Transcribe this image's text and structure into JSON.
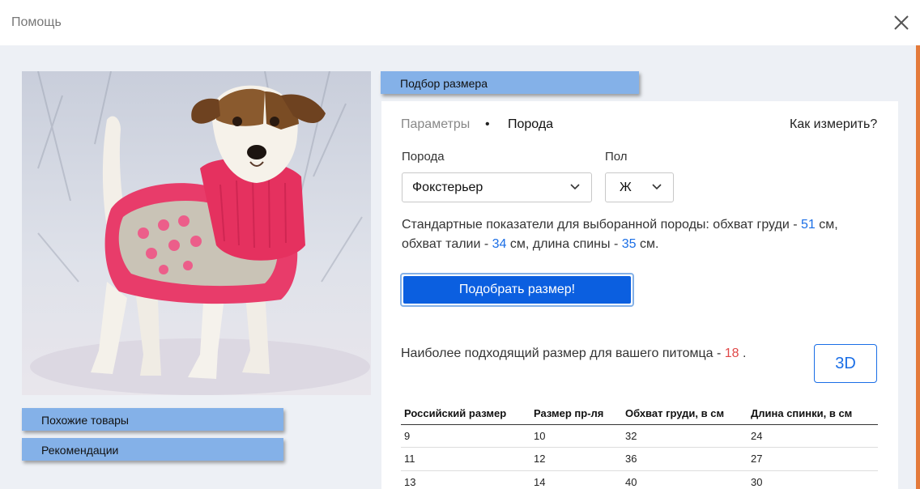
{
  "window": {
    "title": "Помощь",
    "close_icon": "close-icon"
  },
  "photo": {
    "alt_subject": "dog-in-pink-sweater-image"
  },
  "side_buttons": [
    {
      "label": "Похожие товары"
    },
    {
      "label": "Рекомендации"
    }
  ],
  "tab": {
    "label": "Подбор размера"
  },
  "steps": {
    "params": "Параметры",
    "separator": "•",
    "breed": "Порода"
  },
  "how_to_measure": "Как измерить?",
  "form": {
    "breed_label": "Порода",
    "breed_value": "Фокстерьер",
    "sex_label": "Пол",
    "sex_value": "Ж"
  },
  "standard": {
    "prefix": "Стандартные показатели для выборанной породы: обхват груди - ",
    "chest": "51",
    "mid1": " см, обхват талии - ",
    "waist": "34",
    "mid2": " см, длина спины - ",
    "back": "35",
    "suffix": " см."
  },
  "submit_label": "Подобрать размер!",
  "result": {
    "prefix": "Наиболее подходящий размер для вашего питомца - ",
    "size": "18",
    "suffix": " ."
  },
  "btn_3d": "3D",
  "table": {
    "headers": [
      "Российский размер",
      "Размер пр-ля",
      "Обхват груди, в см",
      "Длина спинки, в см"
    ],
    "rows": [
      [
        "9",
        "10",
        "32",
        "24"
      ],
      [
        "11",
        "12",
        "36",
        "27"
      ],
      [
        "13",
        "14",
        "40",
        "30"
      ]
    ]
  },
  "colors": {
    "accent_blue": "#0b5fe0",
    "chip_blue": "#84b1e8",
    "link_blue": "#1a6ee6",
    "result_red": "#e04848",
    "scroll_accent": "#e47a3a"
  }
}
